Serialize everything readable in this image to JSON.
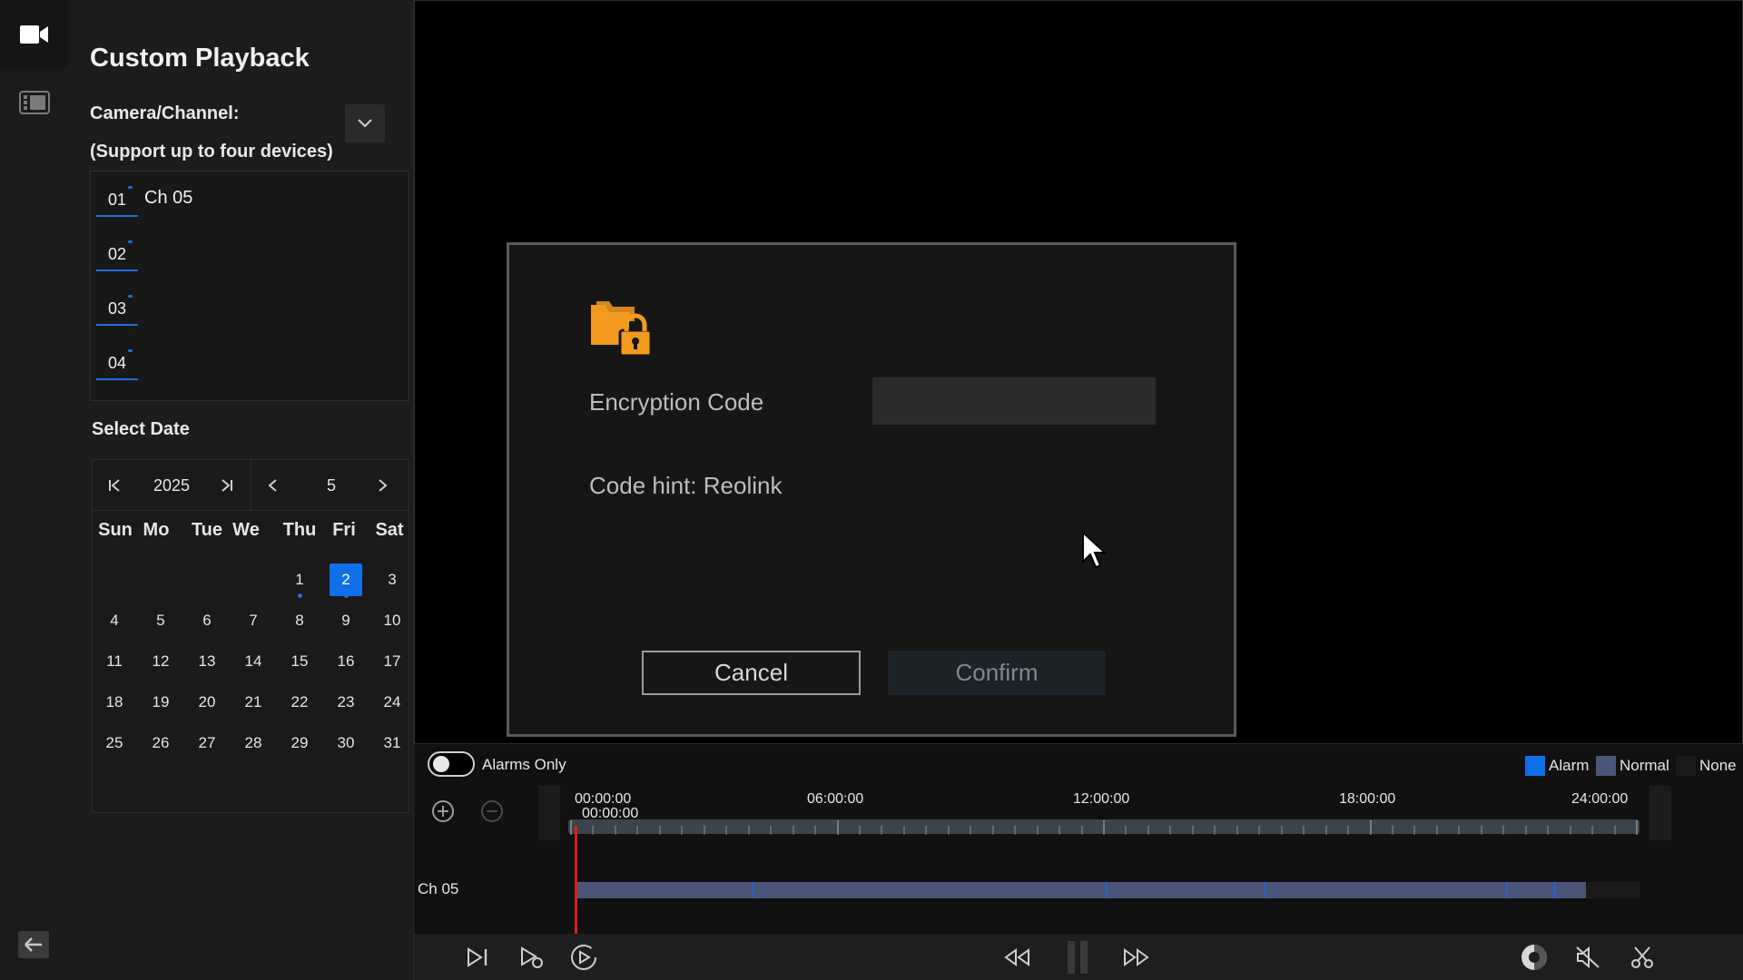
{
  "rail": {
    "top_icon": "video-camera-icon",
    "item_icon": "film-strip-icon",
    "back_icon": "arrow-left-icon"
  },
  "panel": {
    "title": "Custom Playback",
    "camera_label": "Camera/Channel:",
    "support_note": "(Support up to four devices)",
    "slots": [
      {
        "number": "01",
        "name": "Ch 05"
      },
      {
        "number": "02",
        "name": ""
      },
      {
        "number": "03",
        "name": ""
      },
      {
        "number": "04",
        "name": ""
      }
    ],
    "select_date_label": "Select Date"
  },
  "calendar": {
    "year": "2025",
    "month": "5",
    "weekdays": [
      "Sun",
      "Mo",
      "Tue",
      "We",
      "Thu",
      "Fri",
      "Sat"
    ],
    "days": [
      "1",
      "2",
      "3",
      "4",
      "5",
      "6",
      "7",
      "8",
      "9",
      "10",
      "11",
      "12",
      "13",
      "14",
      "15",
      "16",
      "17",
      "18",
      "19",
      "20",
      "21",
      "22",
      "23",
      "24",
      "25",
      "26",
      "27",
      "28",
      "29",
      "30",
      "31"
    ],
    "selected_day": "2",
    "days_with_records": [
      "1",
      "2"
    ]
  },
  "modal": {
    "icon": "locked-folder-icon",
    "encryption_label": "Encryption Code",
    "encryption_value": "",
    "hint": "Code hint: Reolink",
    "cancel_label": "Cancel",
    "confirm_label": "Confirm"
  },
  "timeline": {
    "alarms_only_label": "Alarms Only",
    "alarms_only_on": false,
    "legend": [
      {
        "label": "Alarm",
        "color": "#0f6fe8"
      },
      {
        "label": "Normal",
        "color": "#4a5578"
      },
      {
        "label": "None",
        "color": "#1a1a1a"
      }
    ],
    "ticks": [
      "00:00:00",
      "06:00:00",
      "12:00:00",
      "18:00:00",
      "24:00:00"
    ],
    "current_time": "00:00:00",
    "channel_label": "Ch 05"
  },
  "controls": {
    "left": [
      "next-frame-icon",
      "play-segment-icon",
      "play-circle-icon"
    ],
    "center": [
      "rewind-icon",
      "pause-icon",
      "fast-forward-icon"
    ],
    "right": [
      "brightness-icon",
      "mute-icon",
      "clip-icon"
    ]
  },
  "colors": {
    "accent": "#0f6fe8",
    "playhead": "#e11d1d",
    "lock_orange": "#f39a1e"
  }
}
